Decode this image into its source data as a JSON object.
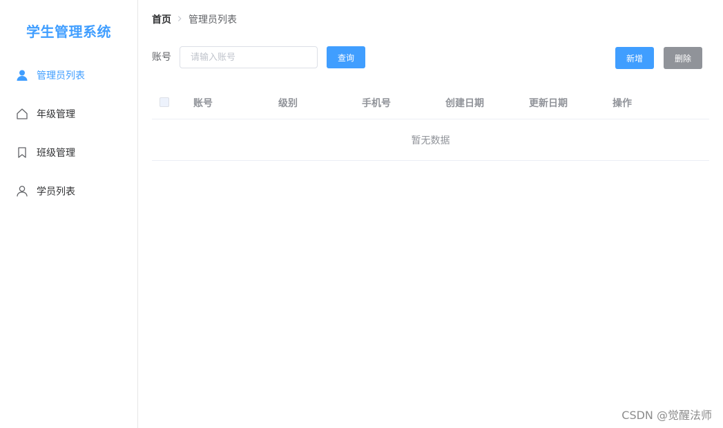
{
  "app": {
    "title": "学生管理系统"
  },
  "sidebar": {
    "items": [
      {
        "label": "管理员列表",
        "icon": "user-filled-icon",
        "active": true
      },
      {
        "label": "年级管理",
        "icon": "house-icon",
        "active": false
      },
      {
        "label": "班级管理",
        "icon": "bookmark-icon",
        "active": false
      },
      {
        "label": "学员列表",
        "icon": "user-icon",
        "active": false
      }
    ]
  },
  "breadcrumb": {
    "home": "首页",
    "separator": ">",
    "current": "管理员列表"
  },
  "search": {
    "label": "账号",
    "placeholder": "请输入账号",
    "value": "",
    "query_label": "查询"
  },
  "toolbar": {
    "add_label": "新增",
    "delete_label": "删除"
  },
  "table": {
    "columns": [
      "账号",
      "级别",
      "手机号",
      "创建日期",
      "更新日期",
      "操作"
    ],
    "empty_text": "暂无数据",
    "rows": []
  },
  "watermark": "CSDN @觉醒法师",
  "colors": {
    "primary": "#409eff",
    "danger_gray": "#909399",
    "border": "#ebeef5"
  }
}
